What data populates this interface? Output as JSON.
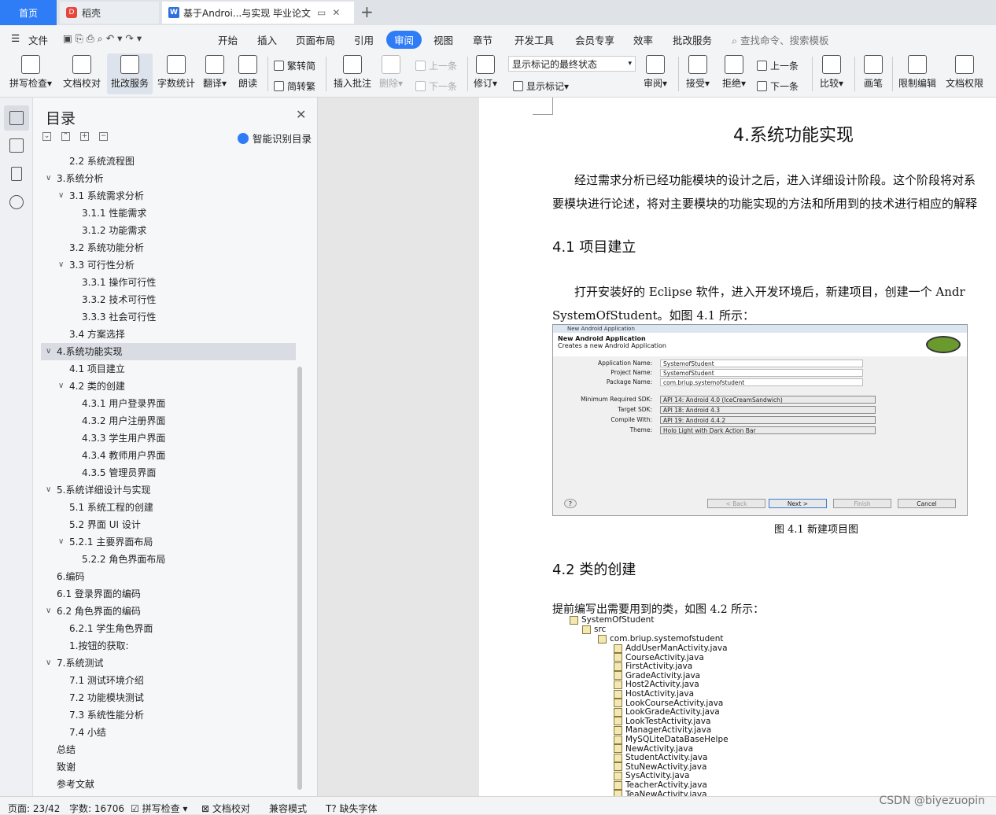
{
  "tabs": {
    "home": "首页",
    "docer": "稻壳",
    "doc": "基于Androi...与实现 毕业论文"
  },
  "menu": {
    "file": "文件",
    "items": [
      "开始",
      "插入",
      "页面布局",
      "引用",
      "审阅",
      "视图",
      "章节",
      "开发工具",
      "会员专享",
      "效率",
      "批改服务"
    ],
    "search_placeholder": "查找命令、搜索模板"
  },
  "ribbon": {
    "spell": "拼写检查",
    "proof": "文档校对",
    "correct": "批改服务",
    "wordcount": "字数统计",
    "translate": "翻译",
    "read": "朗读",
    "trad": "繁转简",
    "simp": "简转繁",
    "insert_comment": "插入批注",
    "delete": "删除",
    "prev": "上一条",
    "next": "下一条",
    "revise": "修订",
    "markup_select": "显示标记的最终状态",
    "show_markup": "显示标记",
    "review": "审阅",
    "accept": "接受",
    "reject": "拒绝",
    "prev2": "上一条",
    "next2": "下一条",
    "compare": "比较",
    "pen": "画笔",
    "restrict": "限制编辑",
    "permission": "文档权限"
  },
  "toc": {
    "title": "目录",
    "smart": "智能识别目录",
    "items": [
      {
        "text": "2.2  系统流程图",
        "level": 2,
        "chev": false
      },
      {
        "text": "3.系统分析",
        "level": 1,
        "chev": true
      },
      {
        "text": "3.1  系统需求分析",
        "level": 2,
        "chev": true
      },
      {
        "text": "3.1.1  性能需求",
        "level": 3,
        "chev": false
      },
      {
        "text": "3.1.2    功能需求",
        "level": 3,
        "chev": false
      },
      {
        "text": "3.2  系统功能分析",
        "level": 2,
        "chev": false
      },
      {
        "text": "3.3 可行性分析",
        "level": 2,
        "chev": true
      },
      {
        "text": "3.3.1 操作可行性",
        "level": 3,
        "chev": false
      },
      {
        "text": "3.3.2 技术可行性",
        "level": 3,
        "chev": false
      },
      {
        "text": "3.3.3 社会可行性",
        "level": 3,
        "chev": false
      },
      {
        "text": "3.4  方案选择",
        "level": 2,
        "chev": false
      },
      {
        "text": "4.系统功能实现",
        "level": 1,
        "chev": true,
        "selected": true
      },
      {
        "text": "4.1  项目建立",
        "level": 2,
        "chev": false
      },
      {
        "text": "4.2  类的创建",
        "level": 2,
        "chev": true
      },
      {
        "text": "4.3.1  用户登录界面",
        "level": 3,
        "chev": false
      },
      {
        "text": "4.3.2  用户注册界面",
        "level": 3,
        "chev": false
      },
      {
        "text": "4.3.3  学生用户界面",
        "level": 3,
        "chev": false
      },
      {
        "text": "4.3.4  教师用户界面",
        "level": 3,
        "chev": false
      },
      {
        "text": "4.3.5   管理员界面",
        "level": 3,
        "chev": false
      },
      {
        "text": "5.系统详细设计与实现",
        "level": 1,
        "chev": true
      },
      {
        "text": "5.1  系统工程的创建",
        "level": 2,
        "chev": false
      },
      {
        "text": "5.2  界面 UI 设计",
        "level": 2,
        "chev": false
      },
      {
        "text": "5.2.1  主要界面布局",
        "level": 2,
        "chev": true
      },
      {
        "text": "5.2.2  角色界面布局",
        "level": 3,
        "chev": false
      },
      {
        "text": "6.编码",
        "level": 1,
        "chev": false
      },
      {
        "text": "6.1  登录界面的编码",
        "level": 1,
        "chev": false
      },
      {
        "text": "6.2  角色界面的编码",
        "level": 1,
        "chev": true
      },
      {
        "text": "6.2.1  学生角色界面",
        "level": 2,
        "chev": false
      },
      {
        "text": "1.按钮的获取:",
        "level": 2,
        "chev": false
      },
      {
        "text": "7.系统测试",
        "level": 1,
        "chev": true
      },
      {
        "text": "7.1  测试环境介绍",
        "level": 2,
        "chev": false
      },
      {
        "text": "7.2  功能模块测试",
        "level": 2,
        "chev": false
      },
      {
        "text": "7.3  系统性能分析",
        "level": 2,
        "chev": false
      },
      {
        "text": "7.4  小结",
        "level": 2,
        "chev": false
      },
      {
        "text": "总结",
        "level": 1,
        "chev": false
      },
      {
        "text": "致谢",
        "level": 1,
        "chev": false
      },
      {
        "text": "参考文献",
        "level": 1,
        "chev": false
      }
    ]
  },
  "doc": {
    "h1": "4.系统功能实现",
    "p1a": "经过需求分析已经功能模块的设计之后，进入详细设计阶段。这个阶段将对系",
    "p1b": "要模块进行论述，将对主要模块的功能实现的方法和所用到的技术进行相应的解释",
    "h2a": "4.1  项目建立",
    "p2a": "打开安装好的 Eclipse 软件，进入开发环境后，新建项目，创建一个 Andr",
    "p2b": "SystemOfStudent。如图 4.1 所示：",
    "cap1": "图 4.1  新建项目图",
    "h2b": "4.2  类的创建",
    "p3": "提前编写出需要用到的类，如图 4.2 所示："
  },
  "dialog": {
    "title": "New Android Application",
    "heading": "New Android Application",
    "sub": "Creates a new Android Application",
    "fields": [
      {
        "label": "Application Name:",
        "value": "SystemofStudent"
      },
      {
        "label": "Project Name:",
        "value": "SystemofStudent"
      },
      {
        "label": "Package Name:",
        "value": "com.briup.systemofstudent"
      }
    ],
    "selects": [
      {
        "label": "Minimum Required SDK:",
        "value": "API 14: Android 4.0 (IceCreamSandwich)"
      },
      {
        "label": "Target SDK:",
        "value": "API 18: Android 4.3"
      },
      {
        "label": "Compile With:",
        "value": "API 19: Android 4.4.2"
      },
      {
        "label": "Theme:",
        "value": "Holo Light with Dark Action Bar"
      }
    ],
    "buttons": [
      "< Back",
      "Next >",
      "Finish",
      "Cancel"
    ]
  },
  "tree": {
    "root": "SystemOfStudent",
    "src": "src",
    "pkg": "com.briup.systemofstudent",
    "files": [
      "AddUserManActivity.java",
      "CourseActivity.java",
      "FirstActivity.java",
      "GradeActivity.java",
      "Host2Activity.java",
      "HostActivity.java",
      "LookCourseActivity.java",
      "LookGradeActivity.java",
      "LookTestActivity.java",
      "ManagerActivity.java",
      "MySQLiteDataBaseHelpe",
      "NewActivity.java",
      "StudentActivity.java",
      "StuNewActivity.java",
      "SysActivity.java",
      "TeacherActivity.java",
      "TeaNewActivity.java"
    ]
  },
  "status": {
    "page": "页面: 23/42",
    "words": "字数: 16706",
    "spell": "拼写检查",
    "proof": "文档校对",
    "compat": "兼容模式",
    "missing": "缺失字体"
  },
  "watermark": "CSDN @biyezuopin"
}
